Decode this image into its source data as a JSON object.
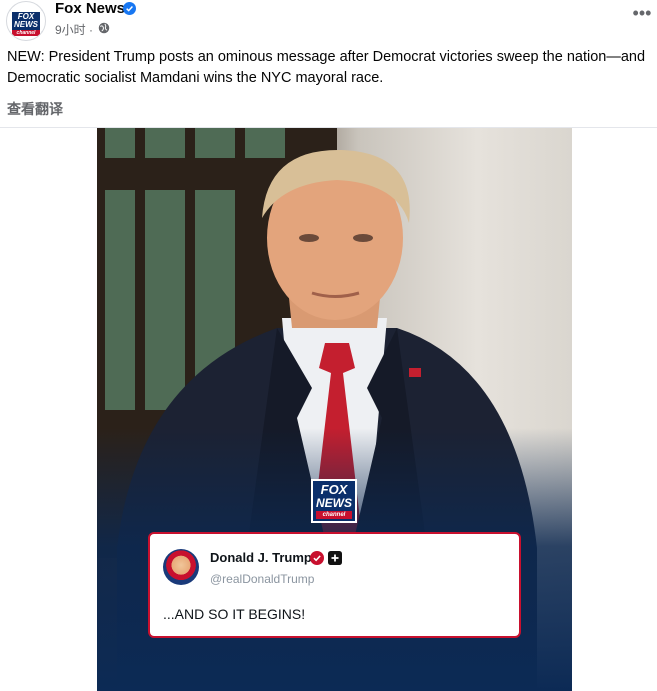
{
  "post": {
    "page_name": "Fox News",
    "time": "9小时",
    "separator": "·",
    "more_label": "•••",
    "text": "NEW: President Trump posts an ominous message after Democrat victories sweep the nation—and Democratic socialist Mamdani wins the NYC mayoral race.",
    "translate_label": "查看翻译"
  },
  "avatar": {
    "line1": "FOX",
    "line2": "NEWS",
    "line3": "channel"
  },
  "media": {
    "logo": {
      "line1": "FOX",
      "line2": "NEWS",
      "line3": "channel"
    },
    "tweet": {
      "name": "Donald J. Trump",
      "handle": "@realDonaldTrump",
      "body": "...AND SO IT BEGINS!"
    }
  },
  "colors": {
    "verified_blue": "#1877f2",
    "fox_navy": "#0b2f6b",
    "fox_red": "#c8102e",
    "meta_gray": "#65676b"
  }
}
